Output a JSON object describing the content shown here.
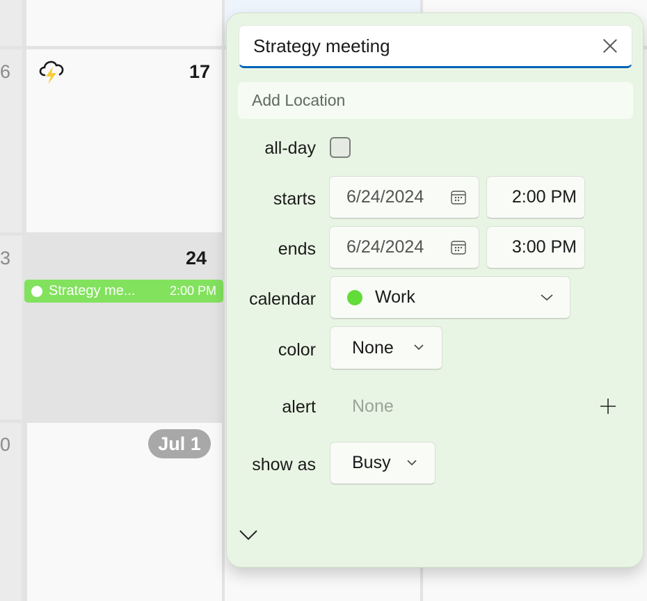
{
  "calendar_grid": {
    "week_numbers": [
      "6",
      "3",
      "0"
    ],
    "days": [
      {
        "label": "17",
        "weather_icon": "thunderstorm-icon"
      },
      {
        "label": "24",
        "is_today": true
      },
      {
        "label": "Jul 1",
        "month_start": true
      }
    ],
    "event": {
      "title": "Strategy me...",
      "time": "2:00 PM",
      "color": "#82e25e"
    }
  },
  "popup": {
    "title_value": "Strategy meeting",
    "location_placeholder": "Add Location",
    "labels": {
      "all_day": "all-day",
      "starts": "starts",
      "ends": "ends",
      "calendar": "calendar",
      "color": "color",
      "alert": "alert",
      "show_as": "show as"
    },
    "all_day_checked": false,
    "start_date": "6/24/2024",
    "start_time": "2:00 PM",
    "end_date": "6/24/2024",
    "end_time": "3:00 PM",
    "calendar_value": "Work",
    "calendar_color": "#62dc38",
    "color_value": "None",
    "alert_value": "None",
    "show_as_value": "Busy",
    "accent_color": "#0063b9"
  }
}
